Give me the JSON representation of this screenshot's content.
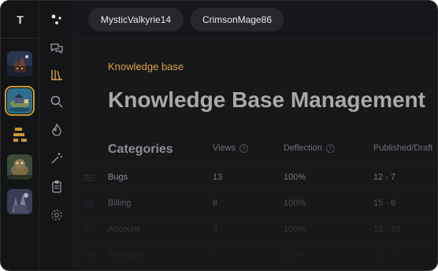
{
  "workspace": {
    "letter": "T"
  },
  "rail_tiles": [
    {
      "name": "castle-thumbnail",
      "active": false
    },
    {
      "name": "island-thumbnail",
      "active": true
    },
    {
      "name": "bars-thumbnail",
      "active": false
    },
    {
      "name": "creature-thumbnail",
      "active": false
    },
    {
      "name": "fortress-thumbnail",
      "active": false
    }
  ],
  "nav_icons": [
    "dots-icon",
    "chat-bubbles-icon",
    "library-icon",
    "search-icon",
    "flame-icon",
    "magic-wand-icon",
    "clipboard-icon",
    "gear-icon"
  ],
  "topbar": {
    "tabs": [
      "MysticValkyrie14",
      "CrimsonMage86"
    ]
  },
  "main": {
    "eyebrow": "Knowledge base",
    "title": "Knowledge Base Management",
    "table": {
      "headers": {
        "category": "Categories",
        "views": "Views",
        "deflection": "Deflection",
        "published": "Published/Draft"
      },
      "rows": [
        {
          "category": "Bugs",
          "views": "13",
          "deflection": "100%",
          "published": "12 · 7"
        },
        {
          "category": "Billing",
          "views": "8",
          "deflection": "100%",
          "published": "15 · 6"
        },
        {
          "category": "Account",
          "views": "3",
          "deflection": "100%",
          "published": "15 · 10"
        },
        {
          "category": "Feedback",
          "views": "3",
          "deflection": "100%",
          "published": "11 · 4"
        }
      ]
    }
  },
  "colors": {
    "accent": "#d8a245",
    "background": "#17181a"
  }
}
